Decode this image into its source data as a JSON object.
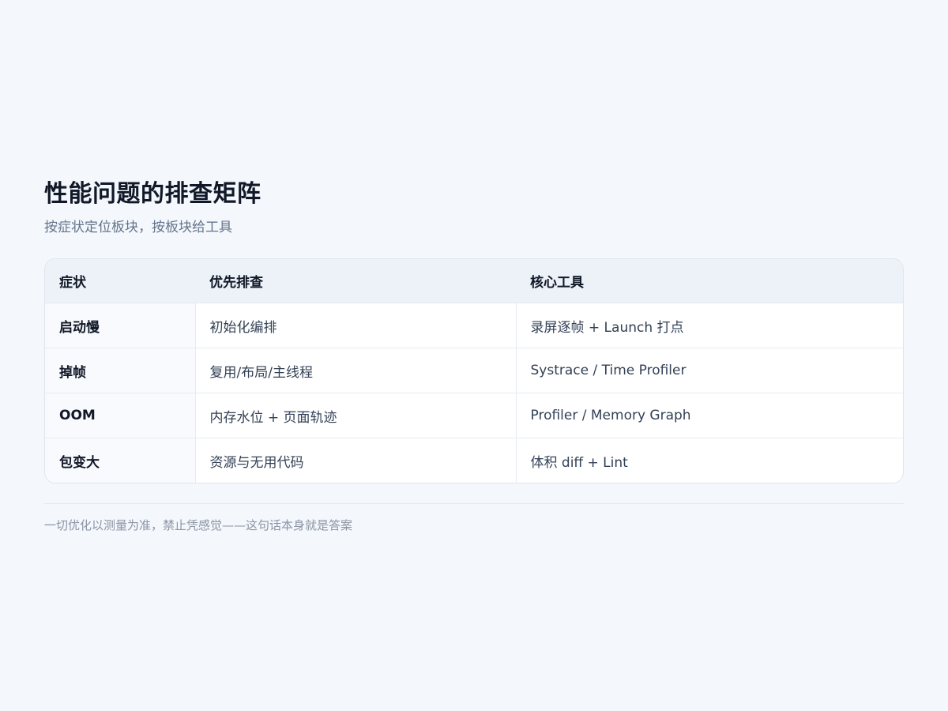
{
  "title": "性能问题的排查矩阵",
  "subtitle": "按症状定位板块，按板块给工具",
  "table": {
    "headers": [
      "症状",
      "优先排查",
      "核心工具"
    ],
    "rows": [
      {
        "symptom": "启动慢",
        "priority": "初始化编排",
        "tools": "录屏逐帧 + Launch 打点"
      },
      {
        "symptom": "掉帧",
        "priority": "复用/布局/主线程",
        "tools": "Systrace / Time Profiler"
      },
      {
        "symptom": "OOM",
        "priority": "内存水位 + 页面轨迹",
        "tools": "Profiler / Memory Graph"
      },
      {
        "symptom": "包变大",
        "priority": "资源与无用代码",
        "tools": "体积 diff + Lint"
      }
    ]
  },
  "footer": "一切优化以测量为准，禁止凭感觉——这句话本身就是答案"
}
